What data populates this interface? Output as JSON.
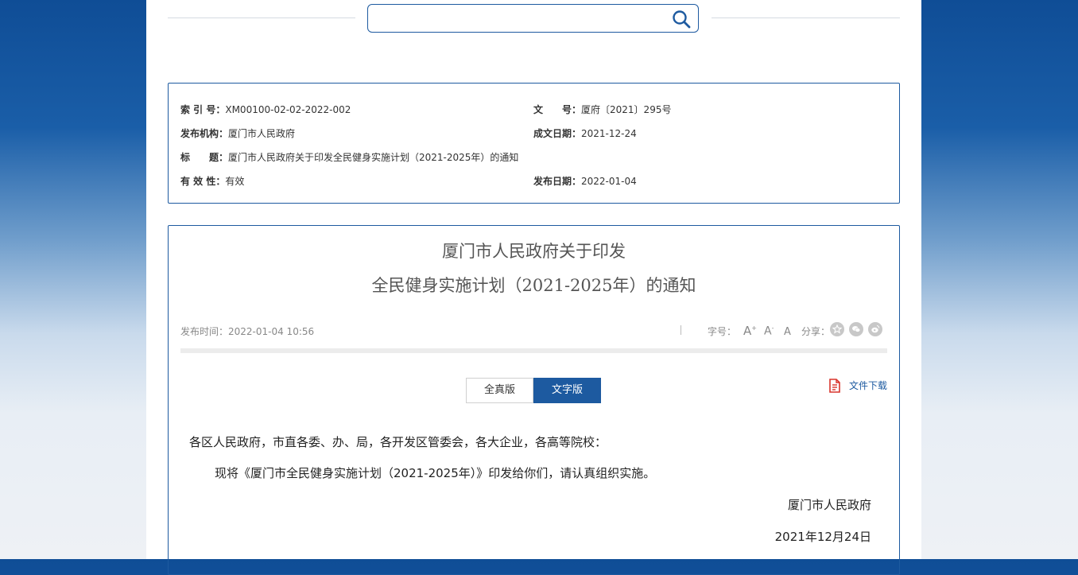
{
  "search": {
    "placeholder": "",
    "value": ""
  },
  "meta": {
    "index_key": "索 引 号：",
    "index_val": "XM00100-02-02-2022-002",
    "docno_key": "文　　号：",
    "docno_val": "厦府〔2021〕295号",
    "org_key": "发布机构：",
    "org_val": "厦门市人民政府",
    "written_key": "成文日期：",
    "written_val": "2021-12-24",
    "title_key": "标　　题：",
    "title_val": "厦门市人民政府关于印发全民健身实施计划（2021-2025年）的通知",
    "validity_key": "有 效 性：",
    "validity_val": "有效",
    "pubdate_key": "发布日期：",
    "pubdate_val": "2022-01-04"
  },
  "article": {
    "title_line1": "厦门市人民政府关于印发",
    "title_line2": "全民健身实施计划（2021-2025年）的通知",
    "pubtime": "发布时间：2022-01-04 10:56",
    "fontsize_label": "字号：",
    "share_label": "分享：",
    "tab_full": "全真版",
    "tab_text": "文字版",
    "download_label": "文件下载",
    "salutation": "各区人民政府，市直各委、办、局，各开发区管委会，各大企业，各高等院校：",
    "paragraph1": "现将《厦门市全民健身实施计划（2021-2025年）》印发给你们，请认真组织实施。",
    "signature": "厦门市人民政府",
    "date": "2021年12月24日"
  },
  "colors": {
    "accent": "#1d5aa0",
    "download_icon": "#d9342b",
    "share_icon": "#c8c8c8"
  },
  "icons": [
    "search-icon",
    "font-large-icon",
    "font-medium-icon",
    "font-small-icon",
    "share-favorite-icon",
    "share-wechat-icon",
    "share-weibo-icon",
    "document-download-icon"
  ]
}
